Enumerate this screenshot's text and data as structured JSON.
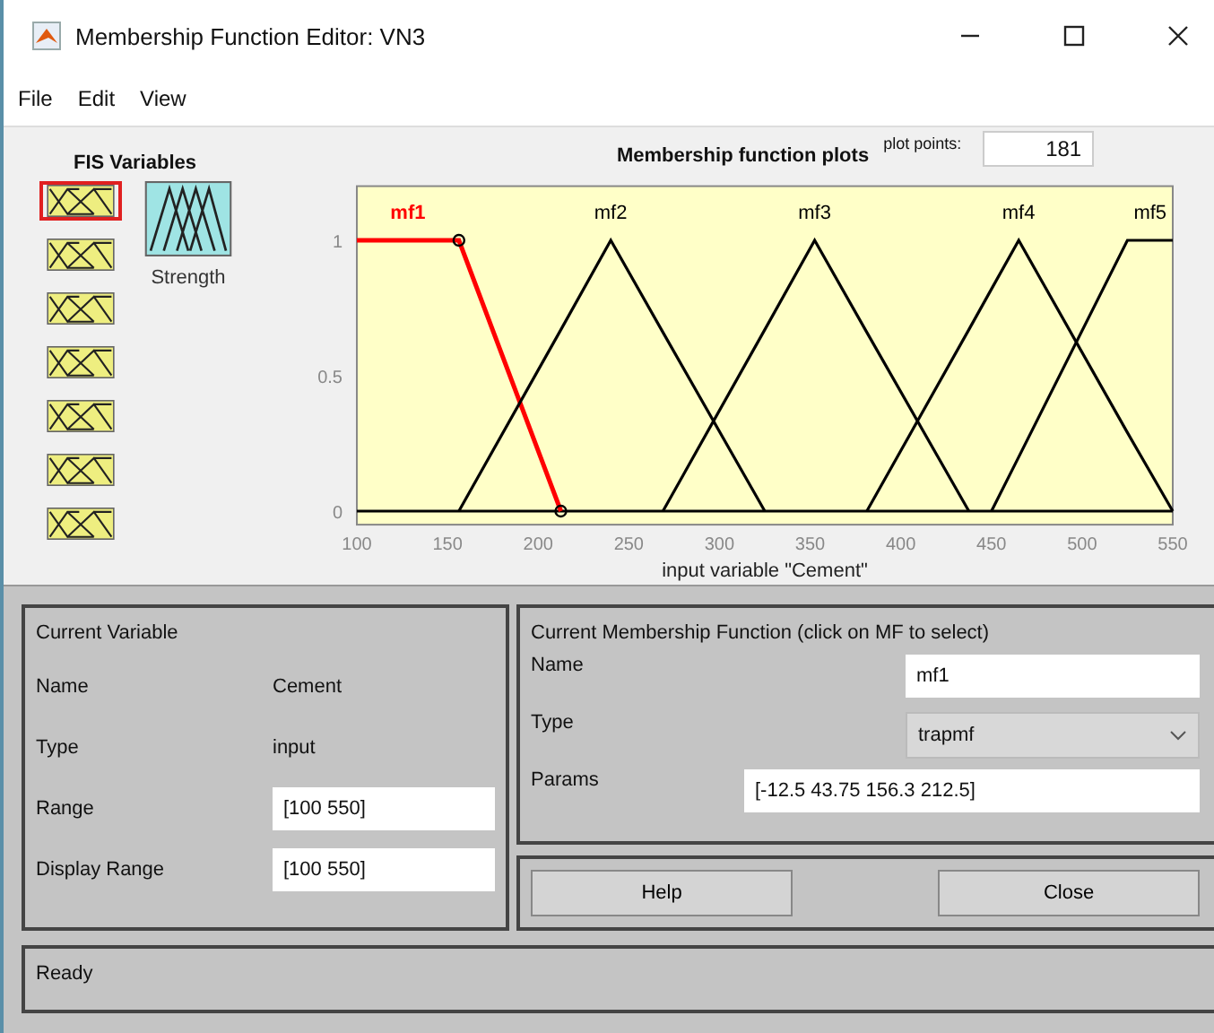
{
  "window": {
    "title": "Membership Function Editor: VN3"
  },
  "menu": [
    "File",
    "Edit",
    "View"
  ],
  "fis_variables": {
    "title": "FIS Variables",
    "inputs": [
      {
        "selected": true
      },
      {
        "selected": false
      },
      {
        "selected": false
      },
      {
        "selected": false
      },
      {
        "selected": false
      },
      {
        "selected": false
      },
      {
        "selected": false
      }
    ],
    "outputs": [
      {
        "label": "Strength",
        "selected": false
      }
    ]
  },
  "plot": {
    "membership_functions": [
      {
        "selected": true
      },
      {
        "selected": false
      },
      {
        "selected": false
      },
      {
        "selected": false
      },
      {
        "selected": false
      }
    ],
    "plot_points_label": "plot points:",
    "plot_points": "181",
    "chart_data": {
      "type": "line",
      "title": "Membership function plots",
      "xlabel": "input variable \"Cement\"",
      "x": [
        100,
        156.3,
        212.5,
        240,
        268.8,
        325,
        352.5,
        381.3,
        437.5,
        450,
        465,
        525,
        550
      ],
      "series": [
        {
          "name": "mf1",
          "color": "#ff0000",
          "values": [
            1,
            1,
            0,
            null,
            null,
            null,
            null,
            null,
            null,
            null,
            null,
            null,
            null
          ]
        },
        {
          "name": "mf2",
          "color": "#000000",
          "values": [
            null,
            0,
            0.67,
            1,
            0.66,
            0,
            null,
            null,
            null,
            null,
            null,
            null,
            null
          ]
        },
        {
          "name": "mf3",
          "color": "#000000",
          "values": [
            null,
            null,
            null,
            null,
            0,
            0.67,
            1,
            0.66,
            0,
            null,
            null,
            null,
            null
          ]
        },
        {
          "name": "mf4",
          "color": "#000000",
          "values": [
            null,
            null,
            null,
            null,
            null,
            null,
            null,
            0,
            0.67,
            0.82,
            1,
            0.29,
            0
          ]
        },
        {
          "name": "mf5",
          "color": "#000000",
          "values": [
            null,
            null,
            null,
            null,
            null,
            null,
            null,
            null,
            null,
            0,
            0.2,
            1,
            1
          ]
        }
      ],
      "xlim": [
        100,
        550
      ],
      "ylim": [
        -0.05,
        1.2
      ],
      "xticks": [
        100,
        150,
        200,
        250,
        300,
        350,
        400,
        450,
        500,
        550
      ],
      "yticks": [
        0,
        0.5,
        1
      ]
    }
  },
  "current_variable": {
    "title": "Current Variable",
    "name_label": "Name",
    "name": "Cement",
    "type_label": "Type",
    "type": "input",
    "range_label": "Range",
    "range": "[100 550]",
    "display_range_label": "Display Range",
    "display_range": "[100 550]"
  },
  "current_mf": {
    "title": "Current Membership Function (click on MF to select)",
    "name_label": "Name",
    "name": "mf1",
    "type_label": "Type",
    "type": "trapmf",
    "params_label": "Params",
    "params": "[-12.5 43.75 156.3 212.5]"
  },
  "buttons": [
    "Help",
    "Close"
  ],
  "status": "Ready"
}
